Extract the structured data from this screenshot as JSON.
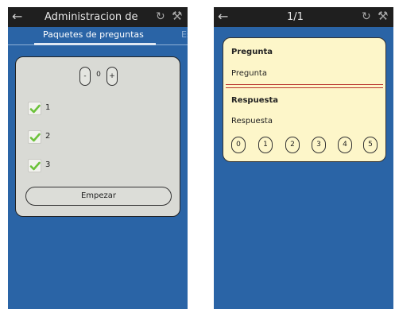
{
  "left_screen": {
    "actionbar": {
      "back_icon": "arrow-left-icon",
      "title": "Administracion de",
      "refresh_icon": "refresh-icon",
      "settings_icon": "wrench-icon"
    },
    "tabs": [
      {
        "label": "Paquetes de preguntas",
        "selected": true
      },
      {
        "label": "Es",
        "selected": false
      }
    ],
    "stepper": {
      "minus": "-",
      "value": "0",
      "plus": "+"
    },
    "items": [
      {
        "label": "1",
        "checked": true
      },
      {
        "label": "2",
        "checked": true
      },
      {
        "label": "3",
        "checked": true
      }
    ],
    "start_button": "Empezar"
  },
  "right_screen": {
    "actionbar": {
      "back_icon": "arrow-left-icon",
      "title": "1/1",
      "refresh_icon": "refresh-icon",
      "settings_icon": "wrench-icon"
    },
    "card": {
      "question_heading": "Pregunta",
      "question_text": "Pregunta",
      "answer_heading": "Respuesta",
      "answer_text": "Respuesta",
      "ratings": [
        "0",
        "1",
        "2",
        "3",
        "4",
        "5"
      ]
    }
  },
  "colors": {
    "background": "#2a64a6",
    "actionbar": "#1f1f1f",
    "card_left": "#d9dad5",
    "card_right": "#fdf6c9",
    "separator": "#b8322c",
    "check": "#6cc23a"
  }
}
